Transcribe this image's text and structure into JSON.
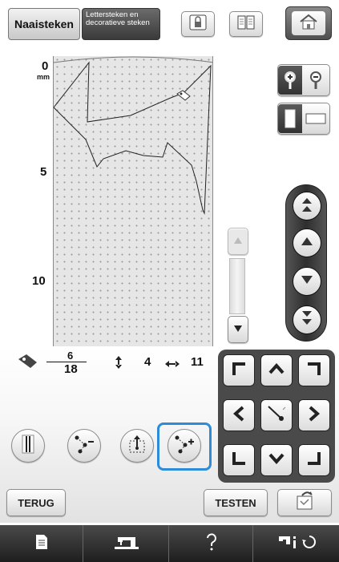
{
  "header": {
    "tab_utility_label": "Naaisteken",
    "tab_decorative_label": "Lettersteken en decoratieve steken",
    "lock_icon": "screen-lock-icon",
    "book_icon": "manual-book-icon",
    "home_icon": "home-icon"
  },
  "scale": {
    "top_value": "0",
    "unit": "mm",
    "mark_5": "5",
    "mark_10": "10"
  },
  "info": {
    "point_current": "6",
    "point_total": "18",
    "vertical_value": "4",
    "horizontal_value": "11"
  },
  "buttons": {
    "back_label": "TERUG",
    "test_label": "TESTEN"
  },
  "colors": {
    "accent_selected": "#2e8bd8",
    "toolbar_dark": "#2a2a2a",
    "canvas_bg": "#e6e6e6"
  }
}
